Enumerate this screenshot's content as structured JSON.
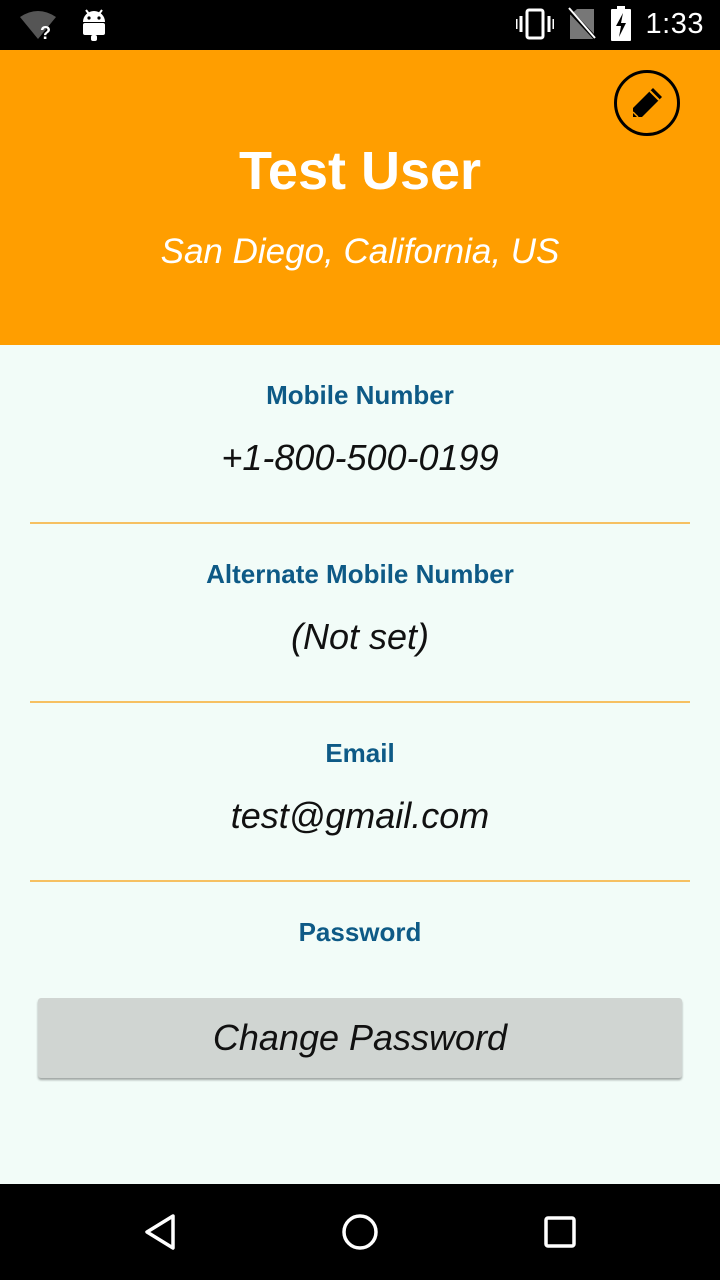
{
  "status_bar": {
    "time": "1:33",
    "icons": [
      "wifi-unknown-icon",
      "android-icon",
      "vibrate-icon",
      "no-sim-icon",
      "battery-charging-icon"
    ]
  },
  "header": {
    "name": "Test User",
    "location": "San Diego, California, US",
    "edit_icon": "pencil-icon",
    "background": "#ff9e00"
  },
  "fields": {
    "mobile": {
      "label": "Mobile Number",
      "value": "+1-800-500-0199"
    },
    "alt_mobile": {
      "label": "Alternate Mobile Number",
      "value": "(Not set)"
    },
    "email": {
      "label": "Email",
      "value": "test@gmail.com"
    },
    "password": {
      "label": "Password"
    }
  },
  "change_password_label": "Change Password",
  "colors": {
    "label": "#0e5a86",
    "divider": "#f6c062",
    "content_bg": "#f2fcf8",
    "button_bg": "#d0d5d2"
  },
  "nav_bar": {
    "icons": [
      "back-icon",
      "home-icon",
      "recents-icon"
    ]
  }
}
